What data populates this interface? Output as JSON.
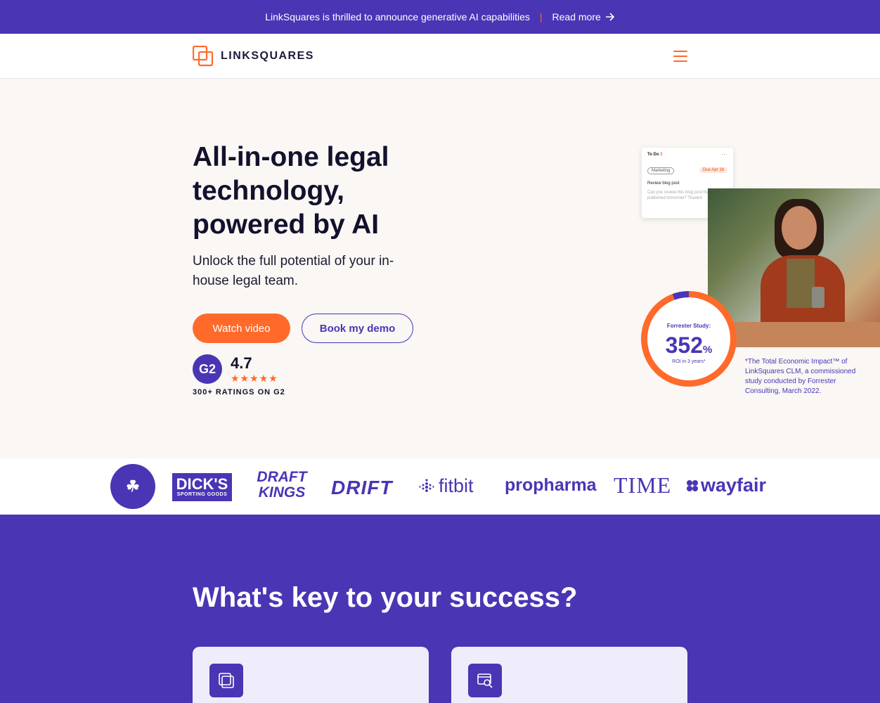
{
  "announcement": {
    "text": "LinkSquares is thrilled to announce generative AI capabilities",
    "separator": "|",
    "link_label": "Read more"
  },
  "nav": {
    "logo_text": "LINKSQUARES",
    "menu_icon": "hamburger-menu-icon"
  },
  "hero": {
    "title": "All-in-one legal technology, powered by AI",
    "subtitle": "Unlock the full potential of your in-house legal team.",
    "primary_button": "Watch video",
    "secondary_button": "Book my demo",
    "rating": {
      "badge": "G2",
      "score": "4.7",
      "stars_value": 4.7,
      "stars": "★★★★★",
      "caption": "300+ RATINGS ON G2"
    }
  },
  "todo_card": {
    "header": "To Do",
    "count": "3",
    "menu": "···",
    "tag": "Marketing",
    "due": "Due Apr 16",
    "task": "Review blog post",
    "description": "Can you review this blog post that will be published tomorrow? Thanks!"
  },
  "stat": {
    "label": "Forrester Study:",
    "value": "352",
    "unit": "%",
    "sub": "ROI in 3 years*",
    "footnote": "*The Total Economic Impact™ of LinkSquares CLM, a commissioned study conducted by Forrester Consulting, March 2022."
  },
  "customer_logos": {
    "celtics": "☘",
    "dicks_main": "DICK'S",
    "dicks_sub": "SPORTING GOODS",
    "draftkings_top": "DRAFT",
    "draftkings_bottom": "KINGS",
    "drift": "DRIFT",
    "fitbit": "fitbit",
    "propharma": "propharma",
    "time": "TIME",
    "wayfair": "wayfair"
  },
  "section": {
    "title": "What's key to your success?"
  },
  "colors": {
    "brand_purple": "#4a35b5",
    "accent_orange": "#ff6a2b",
    "hero_bg": "#faf7f4"
  }
}
